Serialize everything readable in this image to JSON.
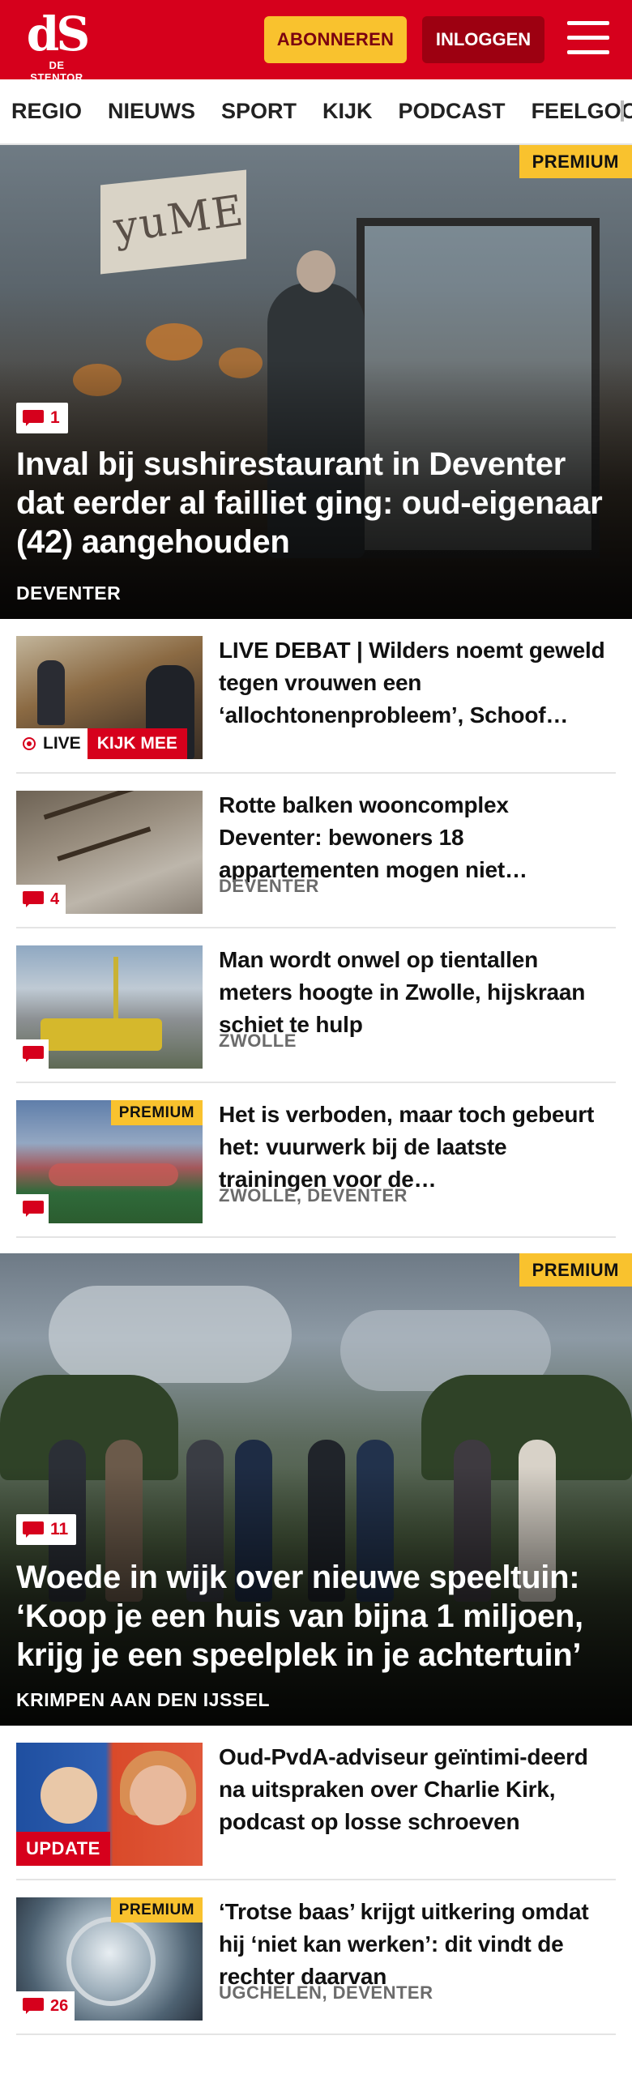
{
  "header": {
    "logo_mark": "dS",
    "logo_text": "DE STENTOR",
    "subscribe_label": "ABONNEREN",
    "login_label": "INLOGGEN"
  },
  "nav": {
    "items": [
      "REGIO",
      "NIEUWS",
      "SPORT",
      "KIJK",
      "PODCAST",
      "FEELGOOD"
    ]
  },
  "hero1": {
    "premium": "PREMIUM",
    "comments": "1",
    "sign_text": "yuME",
    "title": "Inval bij sushirestaurant in Deventer dat eerder al failliet ging: oud-eigenaar (42) aangehouden",
    "location": "DEVENTER"
  },
  "articles_a": [
    {
      "title": "LIVE DEBAT | Wilders noemt geweld tegen vrouwen een ‘allochtonenprobleem’, Schoof…",
      "live_label": "LIVE",
      "watch_label": "KIJK MEE"
    },
    {
      "title": "Rotte balken wooncomplex Deventer: bewoners 18 appartementen mogen niet…",
      "location": "DEVENTER",
      "comments": "4"
    },
    {
      "title": "Man wordt onwel op tientallen meters hoogte in Zwolle, hijskraan schiet te hulp",
      "location": "ZWOLLE"
    },
    {
      "title": "Het is verboden, maar toch gebeurt het: vuurwerk bij de laatste trainingen voor de…",
      "location": "ZWOLLE, DEVENTER",
      "premium": "PREMIUM"
    }
  ],
  "hero2": {
    "premium": "PREMIUM",
    "comments": "11",
    "title": "Woede in wijk over nieuwe speeltuin: ‘Koop je een huis van bijna 1 miljoen, krijg je een speelplek in je achtertuin’",
    "location": "KRIMPEN AAN DEN IJSSEL"
  },
  "articles_b": [
    {
      "title": "Oud-PvdA-adviseur geïntimi-deerd na uitspraken over Charlie Kirk, podcast op losse schroeven",
      "badge": "UPDATE"
    },
    {
      "title": "‘Trotse baas’ krijgt uitkering omdat hij ‘niet kan werken’: dit vindt de rechter daarvan",
      "location": "UGCHELEN, DEVENTER",
      "premium": "PREMIUM",
      "comments": "26"
    }
  ],
  "colors": {
    "brand_red": "#d6001c",
    "premium_yellow": "#f9c22e",
    "login_dark_red": "#9d0011",
    "location_gray": "#6b6b6b"
  },
  "icons": [
    "menu-icon",
    "comment-icon",
    "live-dot-icon"
  ]
}
